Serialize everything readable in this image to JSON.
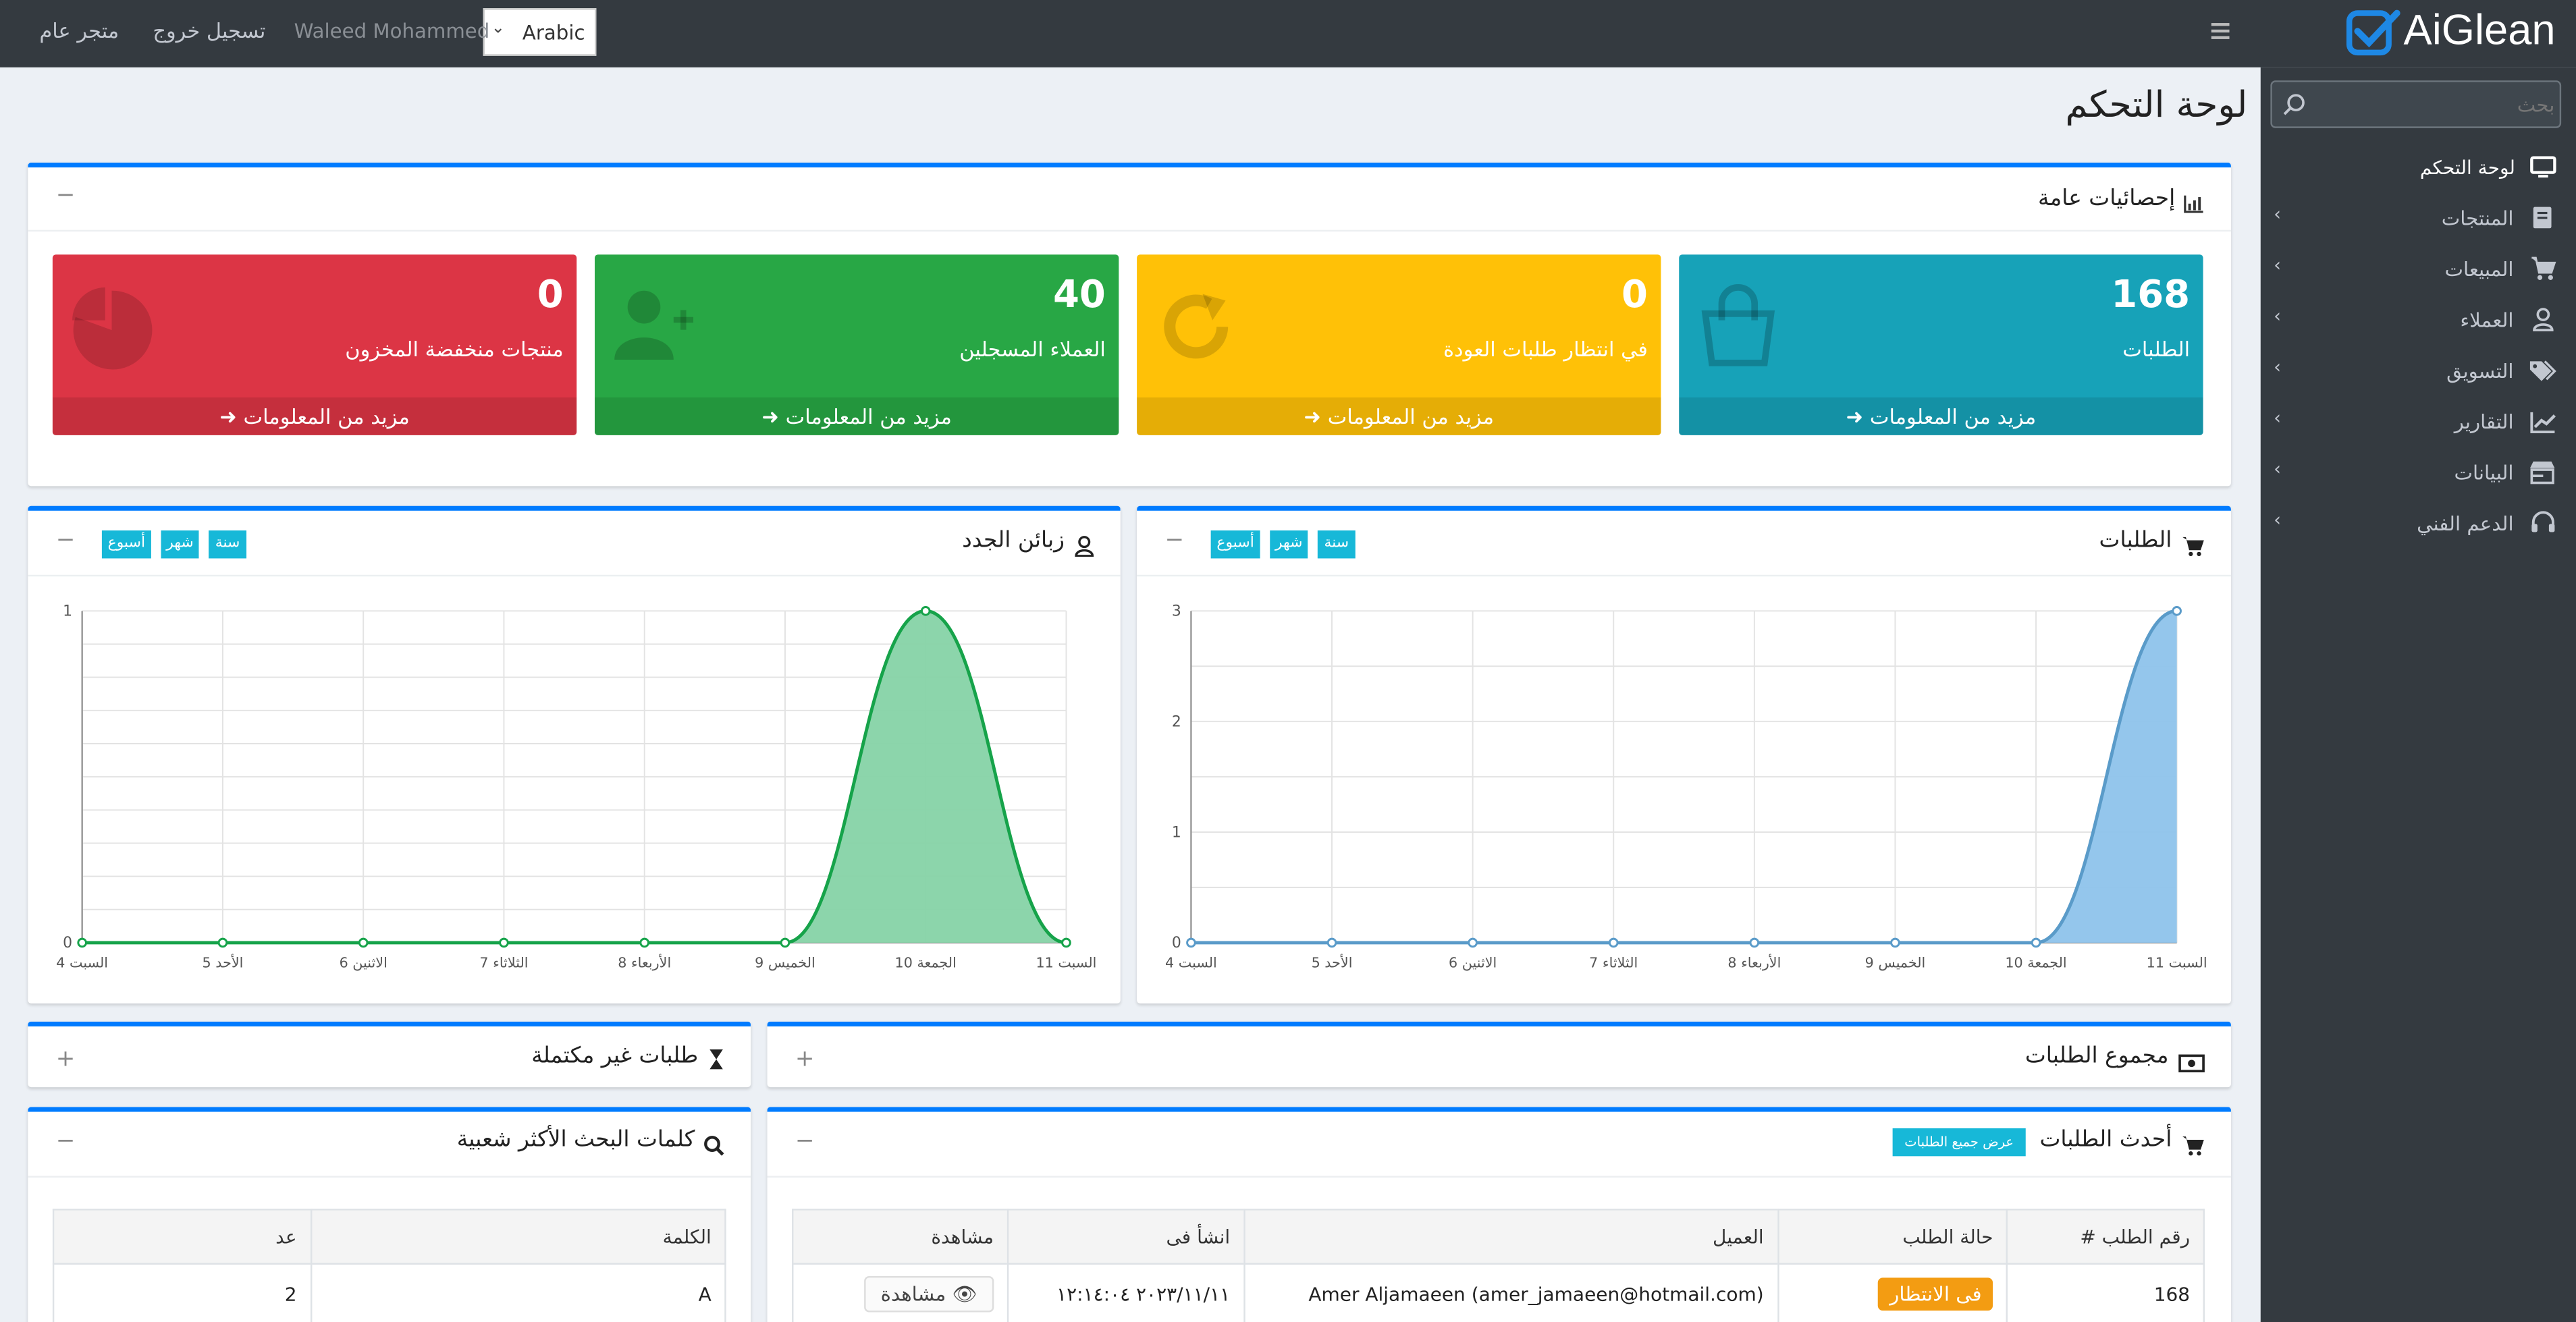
{
  "brand": {
    "name": "AiGlean"
  },
  "topbar": {
    "store": "متجر عام",
    "logout": "تسجيل خروج",
    "user": "Waleed Mohammed",
    "language": "Arabic",
    "menu_icon": "hamburger-icon"
  },
  "sidebar": {
    "search_placeholder": "بحث",
    "items": [
      {
        "label": "لوحة التحكم",
        "icon": "monitor-icon"
      },
      {
        "label": "المنتجات",
        "icon": "book-icon"
      },
      {
        "label": "المبيعات",
        "icon": "cart-icon"
      },
      {
        "label": "العملاء",
        "icon": "user-icon"
      },
      {
        "label": "التسويق",
        "icon": "tags-icon"
      },
      {
        "label": "التقارير",
        "icon": "chart-icon"
      },
      {
        "label": "البيانات",
        "icon": "store-icon"
      },
      {
        "label": "الدعم الفني",
        "icon": "headset-icon"
      }
    ]
  },
  "page": {
    "title": "لوحة التحكم"
  },
  "stats_card": {
    "title": "إحصائيات عامة",
    "more": "مزيد من المعلومات",
    "boxes": [
      {
        "value": "168",
        "label": "الطلبات",
        "color": "#17a2b8",
        "icon": "bag-icon"
      },
      {
        "value": "0",
        "label": "في انتظار طلبات العودة",
        "color": "#ffc107",
        "icon": "refresh-icon"
      },
      {
        "value": "40",
        "label": "العملاء المسجلين",
        "color": "#28a745",
        "icon": "user-plus-icon"
      },
      {
        "value": "0",
        "label": "منتجات منخفضة المخزون",
        "color": "#dc3545",
        "icon": "pie-icon"
      }
    ]
  },
  "orders_card": {
    "title": "الطلبات",
    "periods": [
      "سنة",
      "شهر",
      "أسبوع"
    ]
  },
  "customers_card": {
    "title": "زبائن الجدد",
    "periods": [
      "سنة",
      "شهر",
      "أسبوع"
    ]
  },
  "chart_data": [
    {
      "type": "area",
      "categories": [
        "4 السبت",
        "5 الأحد",
        "6 الاثنين",
        "7 الثلاثاء",
        "8 الأربعاء",
        "9 الخميس",
        "10 الجمعة",
        "11 السبت"
      ],
      "values": [
        0,
        0,
        0,
        0,
        0,
        0,
        0,
        3
      ],
      "ylim": [
        0,
        3
      ],
      "yticks": [
        0,
        1,
        2,
        3
      ],
      "grid": true,
      "color": "#8ec3eb"
    },
    {
      "type": "area",
      "categories": [
        "4 السبت",
        "5 الأحد",
        "6 الاثنين",
        "7 الثلاثاء",
        "8 الأربعاء",
        "9 الخميس",
        "10 الجمعة",
        "11 السبت"
      ],
      "values": [
        0,
        0,
        0,
        0,
        0,
        0,
        1,
        0
      ],
      "ylim": [
        0,
        1
      ],
      "yticks": [
        0,
        1
      ],
      "grid": true,
      "color": "#86d3a6"
    }
  ],
  "total_orders_card": {
    "title": "مجموع الطلبات"
  },
  "incomplete_card": {
    "title": "طلبات غير مكتملة"
  },
  "latest_orders": {
    "title": "أحدث الطلبات",
    "view_all": "عرض جميع الطلبات",
    "columns": [
      "رقم الطلب #",
      "حالة الطلب",
      "العميل",
      "انشأ فى",
      "مشاهدة"
    ],
    "rows": [
      {
        "id": "168",
        "status": "فى الانتظار",
        "customer": "Amer Aljamaeen (amer_jamaeen@hotmail.com)",
        "created": "٢٠٢٣/١١/١١ ١٢:١٤:٠٤",
        "view": "مشاهدة"
      }
    ]
  },
  "search_terms": {
    "title": "كلمات البحث الأكثر شعبية",
    "columns": [
      "الكلمة",
      "عد"
    ],
    "rows": [
      {
        "keyword": "A",
        "count": "2"
      }
    ]
  }
}
